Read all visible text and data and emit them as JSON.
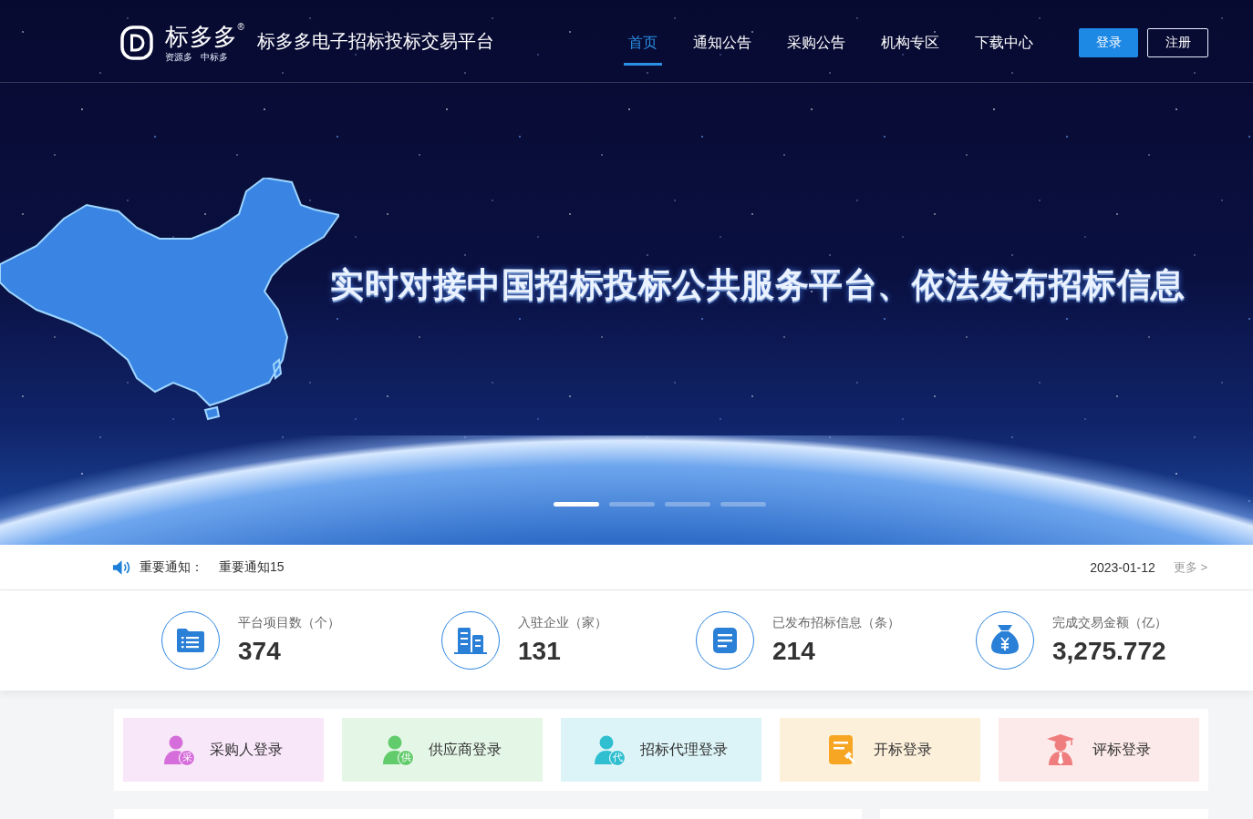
{
  "header": {
    "logo": {
      "brand": "标多多$^{®}$",
      "tagline": "资源多 中标多"
    },
    "platform_title": "标多多电子招标投标交易平台",
    "nav": [
      {
        "label": "首页",
        "selected": true
      },
      {
        "label": "通知公告",
        "selected": false
      },
      {
        "label": "采购公告",
        "selected": false
      },
      {
        "label": "机构专区",
        "selected": false
      },
      {
        "label": "下载中心",
        "selected": false
      }
    ],
    "buttons": [
      {
        "label": "登录",
        "kind": "primary"
      },
      {
        "label": "注册",
        "kind": "outline"
      }
    ]
  },
  "banner": {
    "slogan": "实时对接中国招标投标公共服务平台、依法发布招标信息",
    "slides": [
      {
        "selected": true
      },
      {
        "selected": false
      },
      {
        "selected": false
      },
      {
        "selected": false
      }
    ]
  },
  "notice": {
    "label": "重要通知：",
    "text": "重要通知15",
    "date": "2023-01-12",
    "more": "更多 >"
  },
  "stats": [
    {
      "kind": "folder",
      "label": "平台项目数（个）",
      "value": "374"
    },
    {
      "kind": "building",
      "label": "入驻企业（家）",
      "value": "131"
    },
    {
      "kind": "document",
      "label": "已发布招标信息（条）",
      "value": "214"
    },
    {
      "kind": "money-bag",
      "label": "完成交易金额（亿）",
      "value": "3,275.772"
    }
  ],
  "logins": [
    {
      "kind": "person",
      "label": "采购人登录",
      "badge": "采",
      "color": "#d56edb"
    },
    {
      "kind": "person",
      "label": "供应商登录",
      "badge": "供",
      "color": "#62cc6c"
    },
    {
      "kind": "person",
      "label": "招标代理登录",
      "badge": "代",
      "color": "#2fbfd0"
    },
    {
      "kind": "document",
      "label": "开标登录",
      "color": "#f6a623"
    },
    {
      "kind": "graduate",
      "label": "评标登录",
      "color": "#f07d7d"
    }
  ]
}
